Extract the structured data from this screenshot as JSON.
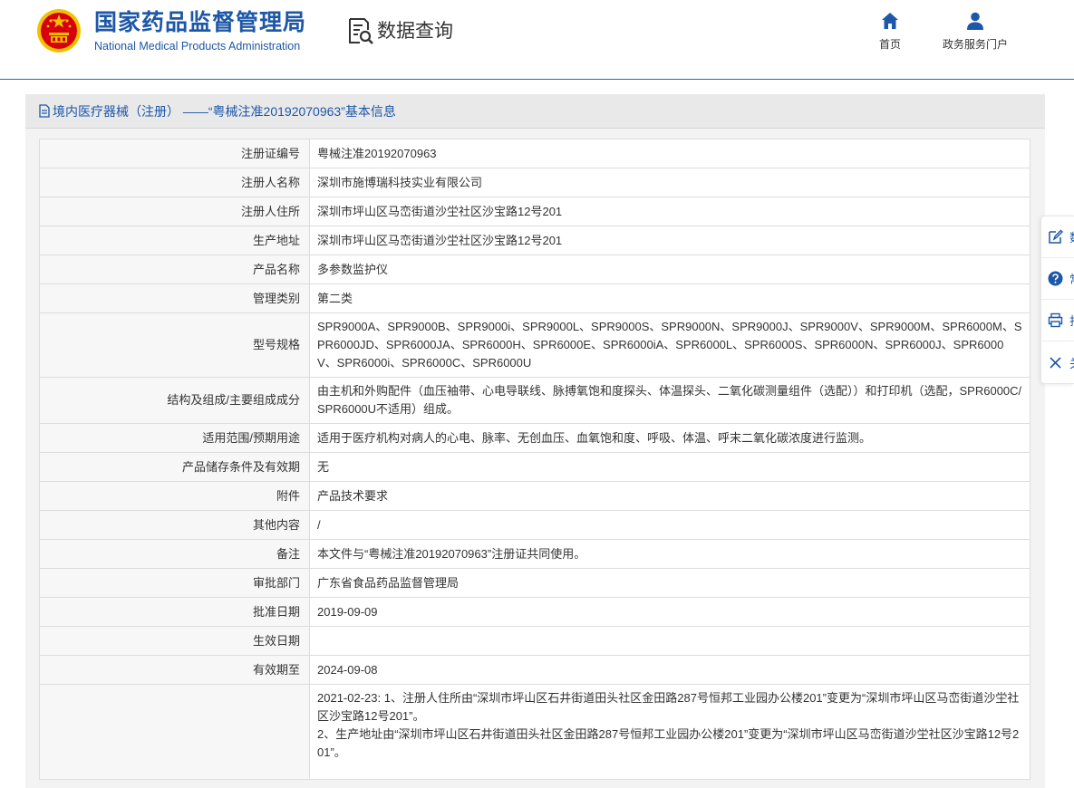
{
  "header": {
    "brand_cn": "国家药品监督管理局",
    "brand_en": "National Medical Products Administration",
    "query_title": "数据查询",
    "nav": [
      {
        "label": "首页",
        "icon": "home-icon"
      },
      {
        "label": "政务服务门户",
        "icon": "user-icon"
      }
    ]
  },
  "panel": {
    "title": "境内医疗器械（注册） ——“粤械注准20192070963”基本信息"
  },
  "rows": [
    {
      "label": "注册证编号",
      "value": "粤械注准20192070963"
    },
    {
      "label": "注册人名称",
      "value": "深圳市施博瑞科技实业有限公司"
    },
    {
      "label": "注册人住所",
      "value": "深圳市坪山区马峦街道沙坣社区沙宝路12号201"
    },
    {
      "label": "生产地址",
      "value": "深圳市坪山区马峦街道沙坣社区沙宝路12号201"
    },
    {
      "label": "产品名称",
      "value": "多参数监护仪"
    },
    {
      "label": "管理类别",
      "value": "第二类"
    },
    {
      "label": "型号规格",
      "value": "SPR9000A、SPR9000B、SPR9000i、SPR9000L、SPR9000S、SPR9000N、SPR9000J、SPR9000V、SPR9000M、SPR6000M、SPR6000JD、SPR6000JA、SPR6000H、SPR6000E、SPR6000iA、SPR6000L、SPR6000S、SPR6000N、SPR6000J、SPR6000V、SPR6000i、SPR6000C、SPR6000U"
    },
    {
      "label": "结构及组成/主要组成成分",
      "value": "由主机和外购配件（血压袖带、心电导联线、脉搏氧饱和度探头、体温探头、二氧化碳测量组件（选配））和打印机（选配，SPR6000C/SPR6000U不适用）组成。"
    },
    {
      "label": "适用范围/预期用途",
      "value": "适用于医疗机构对病人的心电、脉率、无创血压、血氧饱和度、呼吸、体温、呼末二氧化碳浓度进行监测。"
    },
    {
      "label": "产品储存条件及有效期",
      "value": "无"
    },
    {
      "label": "附件",
      "value": "产品技术要求"
    },
    {
      "label": "其他内容",
      "value": "/"
    },
    {
      "label": "备注",
      "value": "本文件与“粤械注准20192070963”注册证共同使用。"
    },
    {
      "label": "审批部门",
      "value": "广东省食品药品监督管理局"
    },
    {
      "label": "批准日期",
      "value": "2019-09-09"
    },
    {
      "label": "生效日期",
      "value": ""
    },
    {
      "label": "有效期至",
      "value": "2024-09-08"
    }
  ],
  "change_history": [
    "2021-02-23: 1、注册人住所由“深圳市坪山区石井街道田头社区金田路287号恒邦工业园办公楼201”变更为“深圳市坪山区马峦街道沙坣社区沙宝路12号201”。",
    "2、生产地址由“深圳市坪山区石井街道田头社区金田路287号恒邦工业园办公楼201”变更为“深圳市坪山区马峦街道沙坣社区沙宝路12号201”。"
  ],
  "float_bar": [
    {
      "label": "数",
      "icon": "edit-icon"
    },
    {
      "label": "常",
      "icon": "help-icon"
    },
    {
      "label": "打",
      "icon": "print-icon"
    },
    {
      "label": "关",
      "icon": "close-icon"
    }
  ],
  "colors": {
    "brand_blue": "#1d57a7",
    "emblem_red": "#d7000f",
    "emblem_gold": "#f2c200"
  }
}
